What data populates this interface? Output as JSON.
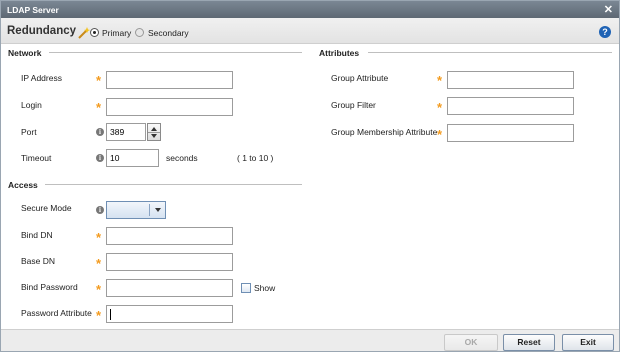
{
  "window": {
    "title": "LDAP Server"
  },
  "redundancy": {
    "label": "Redundancy",
    "primary_label": "Primary",
    "secondary_label": "Secondary",
    "selected": "Primary"
  },
  "network": {
    "heading": "Network",
    "ip_address": {
      "label": "IP Address",
      "value": ""
    },
    "login": {
      "label": "Login",
      "value": ""
    },
    "port": {
      "label": "Port",
      "value": "389"
    },
    "timeout": {
      "label": "Timeout",
      "value": "10",
      "unit": "seconds",
      "range": "( 1 to 10 )"
    }
  },
  "access": {
    "heading": "Access",
    "secure_mode": {
      "label": "Secure Mode",
      "value": ""
    },
    "bind_dn": {
      "label": "Bind DN",
      "value": ""
    },
    "base_dn": {
      "label": "Base DN",
      "value": ""
    },
    "bind_password": {
      "label": "Bind Password",
      "value": "",
      "show_label": "Show",
      "show_checked": false
    },
    "password_attribute": {
      "label": "Password Attribute",
      "value": ""
    }
  },
  "attributes": {
    "heading": "Attributes",
    "group_attribute": {
      "label": "Group Attribute",
      "value": ""
    },
    "group_filter": {
      "label": "Group Filter",
      "value": ""
    },
    "group_membership_attribute": {
      "label": "Group Membership Attribute",
      "value": ""
    }
  },
  "footer": {
    "ok_label": "OK",
    "reset_label": "Reset",
    "exit_label": "Exit"
  },
  "colors": {
    "required_star": "#f39b1f",
    "titlebar": "#6b7682",
    "help": "#1f63b5"
  }
}
